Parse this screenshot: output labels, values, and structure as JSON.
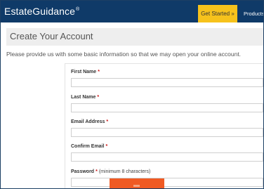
{
  "header": {
    "logo_text": "EstateGuidance",
    "logo_mark": "®",
    "get_started_label": "Get Started »",
    "products_label": "Products"
  },
  "page": {
    "title": "Create Your Account",
    "intro": "Please provide us with some basic information so that we may open your online account."
  },
  "form": {
    "required_mark": "*",
    "fields": [
      {
        "label": "First Name",
        "value": ""
      },
      {
        "label": "Last Name",
        "value": ""
      },
      {
        "label": "Email Address",
        "value": ""
      },
      {
        "label": "Confirm Email",
        "value": ""
      },
      {
        "label": "Password",
        "hint": "(minimum 8 characters)",
        "value": ""
      }
    ]
  },
  "colors": {
    "header_bg": "#0f3a68",
    "cta_bg": "#f6c21c",
    "submit_bg": "#f05a23",
    "required": "#cc1111"
  }
}
